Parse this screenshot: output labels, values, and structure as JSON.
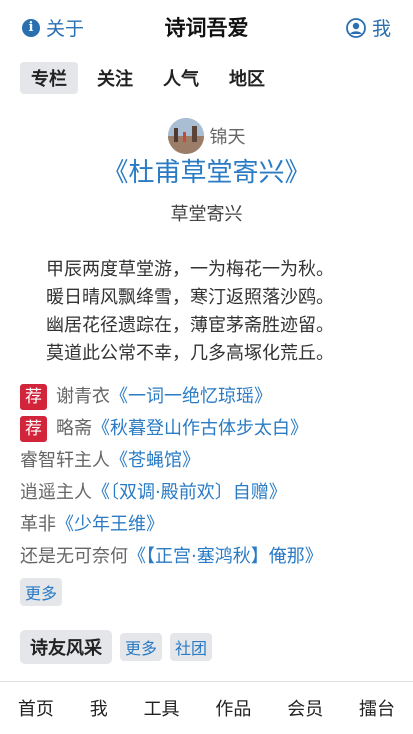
{
  "header": {
    "about_label": "关于",
    "title": "诗词吾爱",
    "me_label": "我"
  },
  "tabs": [
    {
      "label": "专栏",
      "active": true
    },
    {
      "label": "关注",
      "active": false
    },
    {
      "label": "人气",
      "active": false
    },
    {
      "label": "地区",
      "active": false
    }
  ],
  "poem": {
    "author": "锦天",
    "title": "《杜甫草堂寄兴》",
    "subtitle": "草堂寄兴",
    "lines": [
      "甲辰两度草堂游，一为梅花一为秋。",
      "暖日晴风飘绛雪，寒汀返照落沙鸥。",
      "幽居花径遗踪在，薄宦茅斋胜迹留。",
      "莫道此公常不幸，几多高塚化荒丘。"
    ]
  },
  "recommendations": {
    "badge_label": "荐",
    "items": [
      {
        "author": "谢青衣",
        "title": "《一词一绝忆琼瑶》",
        "recommended": true
      },
      {
        "author": "略斋",
        "title": "《秋暮登山作古体步太白》",
        "recommended": true
      },
      {
        "author": "睿智轩主人",
        "title": "《苍蝇馆》",
        "recommended": false
      },
      {
        "author": "逍遥主人",
        "title": "《〔双调·殿前欢〕自赠》",
        "recommended": false
      },
      {
        "author": "革非",
        "title": "《少年王维》",
        "recommended": false
      },
      {
        "author": "还是无可奈何",
        "title": "《【正宫·塞鸿秋】俺那》",
        "recommended": false
      }
    ],
    "more_label": "更多"
  },
  "poet_section": {
    "heading": "诗友风采",
    "more_label": "更多",
    "club_label": "社团"
  },
  "bottom_nav": [
    "首页",
    "我",
    "工具",
    "作品",
    "会员",
    "擂台"
  ],
  "colors": {
    "link": "#2a7bc4",
    "badge": "#d2243a",
    "chip_bg": "#e4e6ea"
  }
}
